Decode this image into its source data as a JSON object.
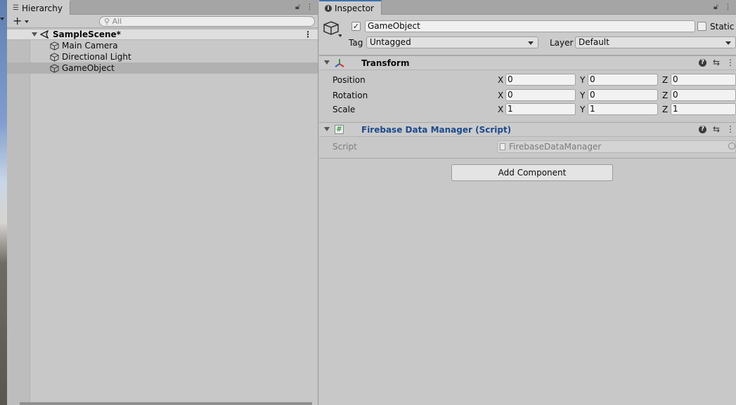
{
  "hierarchy": {
    "tab_label": "Hierarchy",
    "search_placeholder": "All",
    "scene_name": "SampleScene*",
    "items": [
      {
        "label": "Main Camera"
      },
      {
        "label": "Directional Light"
      },
      {
        "label": "GameObject",
        "selected": true
      }
    ]
  },
  "inspector": {
    "tab_label": "Inspector",
    "object_name": "GameObject",
    "active": true,
    "static_label": "Static",
    "tag_label": "Tag",
    "tag_value": "Untagged",
    "layer_label": "Layer",
    "layer_value": "Default",
    "transform": {
      "title": "Transform",
      "rows": [
        {
          "label": "Position",
          "x": "0",
          "y": "0",
          "z": "0"
        },
        {
          "label": "Rotation",
          "x": "0",
          "y": "0",
          "z": "0"
        },
        {
          "label": "Scale",
          "x": "1",
          "y": "1",
          "z": "1"
        }
      ],
      "axes": {
        "x": "X",
        "y": "Y",
        "z": "Z"
      }
    },
    "script_component": {
      "title": "Firebase Data Manager (Script)",
      "script_label": "Script",
      "script_value": "FirebaseDataManager"
    },
    "add_component_label": "Add Component"
  },
  "colors": {
    "accent": "#3a72b0",
    "script_title": "#1c4a8c",
    "panel_bg": "#c8c8c8"
  }
}
